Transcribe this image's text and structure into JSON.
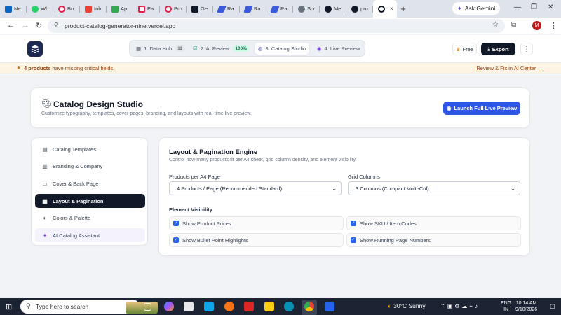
{
  "browser": {
    "tabs": [
      {
        "label": "Ne",
        "color": "#0a66c2"
      },
      {
        "label": "Wh",
        "color": "#25d366"
      },
      {
        "label": "Bu",
        "color": "#e11d48"
      },
      {
        "label": "Inb",
        "color": "#ea4335"
      },
      {
        "label": "Ap",
        "color": "#34a853"
      },
      {
        "label": "Ea",
        "color": "#e11d48"
      },
      {
        "label": "Pro",
        "color": "#e11d48"
      },
      {
        "label": "Ge",
        "color": "#111827"
      },
      {
        "label": "Ra",
        "color": "#3b5bdb"
      },
      {
        "label": "Ra",
        "color": "#3b5bdb"
      },
      {
        "label": "Ra",
        "color": "#3b5bdb"
      },
      {
        "label": "Scr",
        "color": "#6b7280"
      },
      {
        "label": "Me",
        "color": "#111827"
      },
      {
        "label": "pro",
        "color": "#111827"
      },
      {
        "label": "",
        "color": "#111827"
      }
    ],
    "new_tab": "+",
    "gemini_label": "Ask Gemini",
    "url": "product-catalog-generator-nine.vercel.app",
    "profile_initial": "M"
  },
  "header": {
    "steps": [
      {
        "label": "1. Data Hub",
        "badge": "11",
        "icon": "grid-icon"
      },
      {
        "label": "2. AI Review",
        "badge": "100%",
        "icon": "check-square-icon"
      },
      {
        "label": "3. Catalog Studio",
        "badge": "",
        "icon": "palette-icon"
      },
      {
        "label": "4. Live Preview",
        "badge": "",
        "icon": "eye-icon"
      }
    ],
    "free_label": "Free",
    "export_label": "Export",
    "menu_label": "⋮"
  },
  "warning": {
    "bold": "4 products",
    "text": " have missing critical fields.",
    "link": "Review & Fix in AI Center →"
  },
  "studio": {
    "title": "Catalog Design Studio",
    "subtitle": "Customize typography, templates, cover pages, branding, and layouts with real-time live preview.",
    "launch_label": "Launch Full Live Preview"
  },
  "sidebar": {
    "items": [
      {
        "label": "Catalog Templates",
        "icon": "template-icon"
      },
      {
        "label": "Branding & Company",
        "icon": "building-icon"
      },
      {
        "label": "Cover & Back Page",
        "icon": "page-icon"
      },
      {
        "label": "Layout & Pagination",
        "icon": "layout-icon"
      },
      {
        "label": "Colors & Palette",
        "icon": "palette-icon"
      },
      {
        "label": "AI Catalog Assistant",
        "icon": "sparkle-icon"
      }
    ]
  },
  "main": {
    "title": "Layout & Pagination Engine",
    "subtitle": "Control how many products fit per A4 sheet, grid column density, and element visibility.",
    "products_label": "Products per A4 Page",
    "products_value": "4 Products / Page (Recommended Standard)",
    "grid_label": "Grid Columns",
    "grid_value": "3 Columns (Compact Multi-Col)",
    "visibility_label": "Element Visibility",
    "checks": [
      {
        "label": "Show Product Prices",
        "checked": true
      },
      {
        "label": "Show SKU / Item Codes",
        "checked": true
      },
      {
        "label": "Show Bullet Point Highlights",
        "checked": true
      },
      {
        "label": "Show Running Page Numbers",
        "checked": true
      }
    ]
  },
  "taskbar": {
    "search_placeholder": "Type here to search",
    "weather": "30°C  Sunny",
    "lang1": "ENG",
    "lang2": "IN",
    "time": "10:14 AM",
    "date": "9/10/2026"
  }
}
